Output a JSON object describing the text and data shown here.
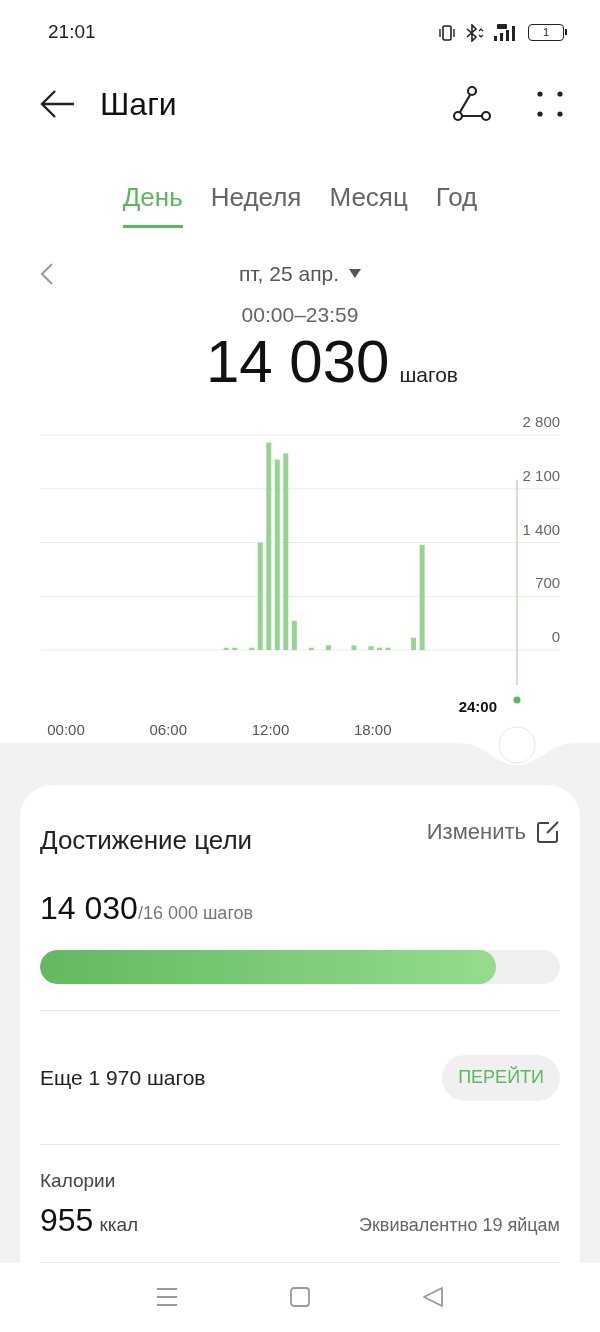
{
  "status_bar": {
    "time": "21:01",
    "battery": "1"
  },
  "header": {
    "title": "Шаги"
  },
  "tabs": [
    {
      "label": "День",
      "selected": true
    },
    {
      "label": "Неделя",
      "selected": false
    },
    {
      "label": "Месяц",
      "selected": false
    },
    {
      "label": "Год",
      "selected": false
    }
  ],
  "date": "пт, 25 апр.",
  "time_range": "00:00–23:59",
  "total": {
    "value": "14 030",
    "unit": "шагов"
  },
  "chart": {
    "cursor_label": "24:00",
    "chart_data": {
      "type": "bar",
      "x": [
        9.4,
        9.9,
        10.9,
        11.4,
        11.9,
        12.4,
        12.9,
        13.4,
        14.4,
        15.4,
        16.9,
        17.9,
        18.4,
        18.9,
        20.4,
        20.9
      ],
      "values": [
        30,
        30,
        30,
        1400,
        2700,
        2480,
        2560,
        380,
        30,
        60,
        60,
        50,
        30,
        30,
        160,
        1370
      ],
      "xlim": [
        -1.5,
        29
      ],
      "ylim": [
        0,
        2800
      ],
      "grid": true,
      "xticks": [
        {
          "value": 0,
          "label": "00:00"
        },
        {
          "value": 6,
          "label": "06:00"
        },
        {
          "value": 12,
          "label": "12:00"
        },
        {
          "value": 18,
          "label": "18:00"
        }
      ],
      "yticks": [
        {
          "value": 0,
          "label": "0"
        },
        {
          "value": 700,
          "label": "700"
        },
        {
          "value": 1400,
          "label": "1 400"
        },
        {
          "value": 2100,
          "label": "2 100"
        },
        {
          "value": 2800,
          "label": "2 800"
        }
      ]
    }
  },
  "goal": {
    "title": "Достижение цели",
    "edit": "Изменить",
    "current": "14 030",
    "target": "/16 000 шагов",
    "level": 0.877,
    "remaining": "Еще 1 970 шагов",
    "action": "ПЕРЕЙТИ"
  },
  "calories": {
    "label": "Калории",
    "value": "955",
    "unit": "ккал",
    "equivalent": "Эквивалентно 19 яйцам"
  }
}
